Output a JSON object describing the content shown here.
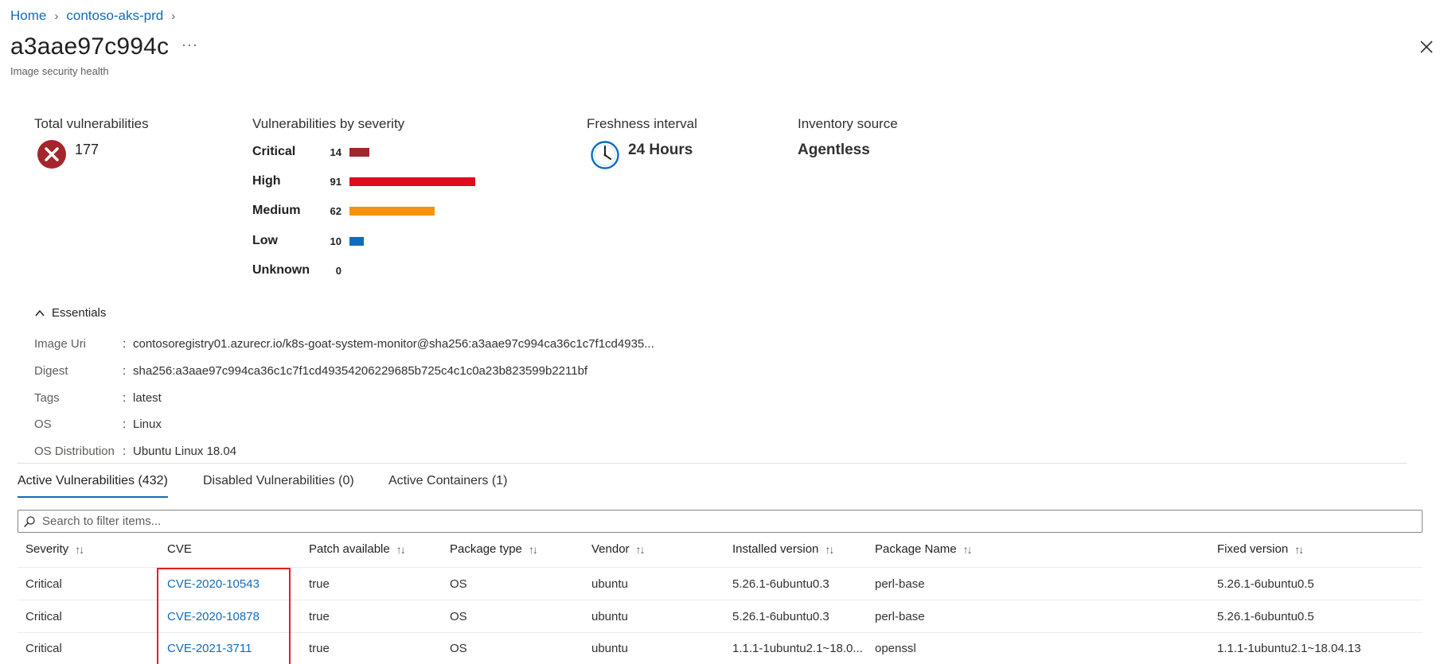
{
  "breadcrumb": {
    "home": "Home",
    "resource": "contoso-aks-prd"
  },
  "header": {
    "title": "a3aae97c994c",
    "more": "···",
    "subtitle": "Image security health"
  },
  "summary": {
    "total_label": "Total vulnerabilities",
    "total_value": "177",
    "severity_label": "Vulnerabilities by severity",
    "severity": [
      {
        "name": "Critical",
        "count": "14",
        "color": "#a4262c"
      },
      {
        "name": "High",
        "count": "91",
        "color": "#e00b1c"
      },
      {
        "name": "Medium",
        "count": "62",
        "color": "#f7920a"
      },
      {
        "name": "Low",
        "count": "10",
        "color": "#0f6cbd"
      },
      {
        "name": "Unknown",
        "count": "0",
        "color": "#8a8886"
      }
    ],
    "freshness_label": "Freshness interval",
    "freshness_value": "24 Hours",
    "inventory_label": "Inventory source",
    "inventory_value": "Agentless"
  },
  "essentials": {
    "toggle_label": "Essentials",
    "rows": [
      {
        "label": "Image Uri",
        "value": "contosoregistry01.azurecr.io/k8s-goat-system-monitor@sha256:a3aae97c994ca36c1c7f1cd4935..."
      },
      {
        "label": "Digest",
        "value": "sha256:a3aae97c994ca36c1c7f1cd49354206229685b725c4c1c0a23b823599b2211bf"
      },
      {
        "label": "Tags",
        "value": "latest"
      },
      {
        "label": "OS",
        "value": "Linux"
      },
      {
        "label": "OS Distribution",
        "value": "Ubuntu Linux 18.04"
      }
    ]
  },
  "tabs": [
    {
      "label": "Active Vulnerabilities (432)"
    },
    {
      "label": "Disabled Vulnerabilities (0)"
    },
    {
      "label": "Active Containers (1)"
    }
  ],
  "search": {
    "placeholder": "Search to filter items..."
  },
  "table": {
    "columns": [
      "Severity",
      "CVE",
      "Patch available",
      "Package type",
      "Vendor",
      "Installed version",
      "Package Name",
      "Fixed version"
    ],
    "rows": [
      [
        "Critical",
        "CVE-2020-10543",
        "true",
        "OS",
        "ubuntu",
        "5.26.1-6ubuntu0.3",
        "perl-base",
        "5.26.1-6ubuntu0.5"
      ],
      [
        "Critical",
        "CVE-2020-10878",
        "true",
        "OS",
        "ubuntu",
        "5.26.1-6ubuntu0.3",
        "perl-base",
        "5.26.1-6ubuntu0.5"
      ],
      [
        "Critical",
        "CVE-2021-3711",
        "true",
        "OS",
        "ubuntu",
        "1.1.1-1ubuntu2.1~18.0...",
        "openssl",
        "1.1.1-1ubuntu2.1~18.04.13"
      ]
    ]
  },
  "colors": {
    "accent": "#0f6cbd",
    "error": "#a4262c",
    "highlight": "#e31e24"
  }
}
